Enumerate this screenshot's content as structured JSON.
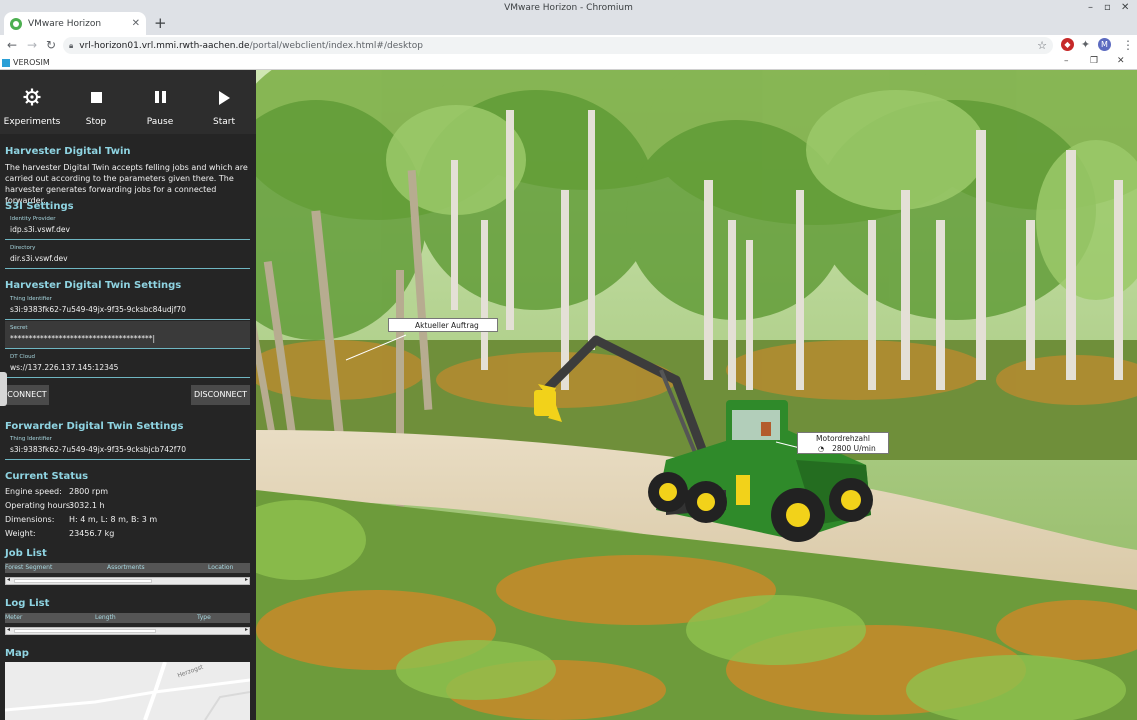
{
  "browser": {
    "window_title": "VMware Horizon - Chromium",
    "tab_title": "VMware Horizon",
    "url_host": "vrl-horizon01.vrl.mmi.rwth-aachen.de",
    "url_path": "/portal/webclient/index.html#/desktop",
    "profile_initial": "M"
  },
  "app": {
    "title": "VEROSIM"
  },
  "controls": [
    {
      "label": "Experiments",
      "icon": "settings-gear-icon"
    },
    {
      "label": "Stop",
      "icon": "stop-icon"
    },
    {
      "label": "Pause",
      "icon": "pause-icon"
    },
    {
      "label": "Start",
      "icon": "play-icon"
    }
  ],
  "harvester": {
    "title": "Harvester Digital Twin",
    "description": "The harvester Digital Twin accepts felling jobs and which are carried out according to the parameters given there. The harvester generates forwarding jobs for a connected forwarder."
  },
  "s3i": {
    "title": "S3I Settings",
    "identity_provider_label": "Identity Provider",
    "identity_provider_value": "idp.s3i.vswf.dev",
    "directory_label": "Directory",
    "directory_value": "dir.s3i.vswf.dev"
  },
  "harvester_settings": {
    "title": "Harvester Digital Twin Settings",
    "thing_id_label": "Thing Identifier",
    "thing_id_value": "s3i:9383fk62-7u549-49jx-9f35-9cksbc84udjf70",
    "secret_label": "Secret",
    "secret_value": "**************************************|",
    "dt_cloud_label": "DT Cloud",
    "dt_cloud_value": "ws://137.226.137.145:12345",
    "connect_label": "CONNECT",
    "disconnect_label": "DISCONNECT"
  },
  "forwarder_settings": {
    "title": "Forwarder Digital Twin Settings",
    "thing_id_label": "Thing Identifier",
    "thing_id_value": "s3i:9383fk62-7u549-49jx-9f35-9cksbjcb742f70"
  },
  "status": {
    "title": "Current Status",
    "rows": [
      {
        "label": "Engine speed:",
        "value": "2800 rpm"
      },
      {
        "label": "Operating hours:",
        "value": "3032.1 h"
      },
      {
        "label": "Dimensions:",
        "value": "H: 4 m, L: 8 m, B: 3 m"
      },
      {
        "label": "Weight:",
        "value": "23456.7 kg"
      }
    ]
  },
  "job_list": {
    "title": "Job List",
    "columns": [
      "Forest Segment",
      "Assortments",
      "Location"
    ]
  },
  "log_list": {
    "title": "Log List",
    "columns": [
      "Meter",
      "Length",
      "Type"
    ]
  },
  "map": {
    "title": "Map",
    "street_label": "Herzogst"
  },
  "scene": {
    "label_order": "Aktueller Auftrag",
    "label_rpm_title": "Motordrehzahl",
    "label_rpm_value": "2800 U/min"
  },
  "colors": {
    "panel_bg": "#252525",
    "accent": "#8fd4e2",
    "machine_green": "#2f8a2a",
    "machine_yellow": "#f2d21a"
  }
}
